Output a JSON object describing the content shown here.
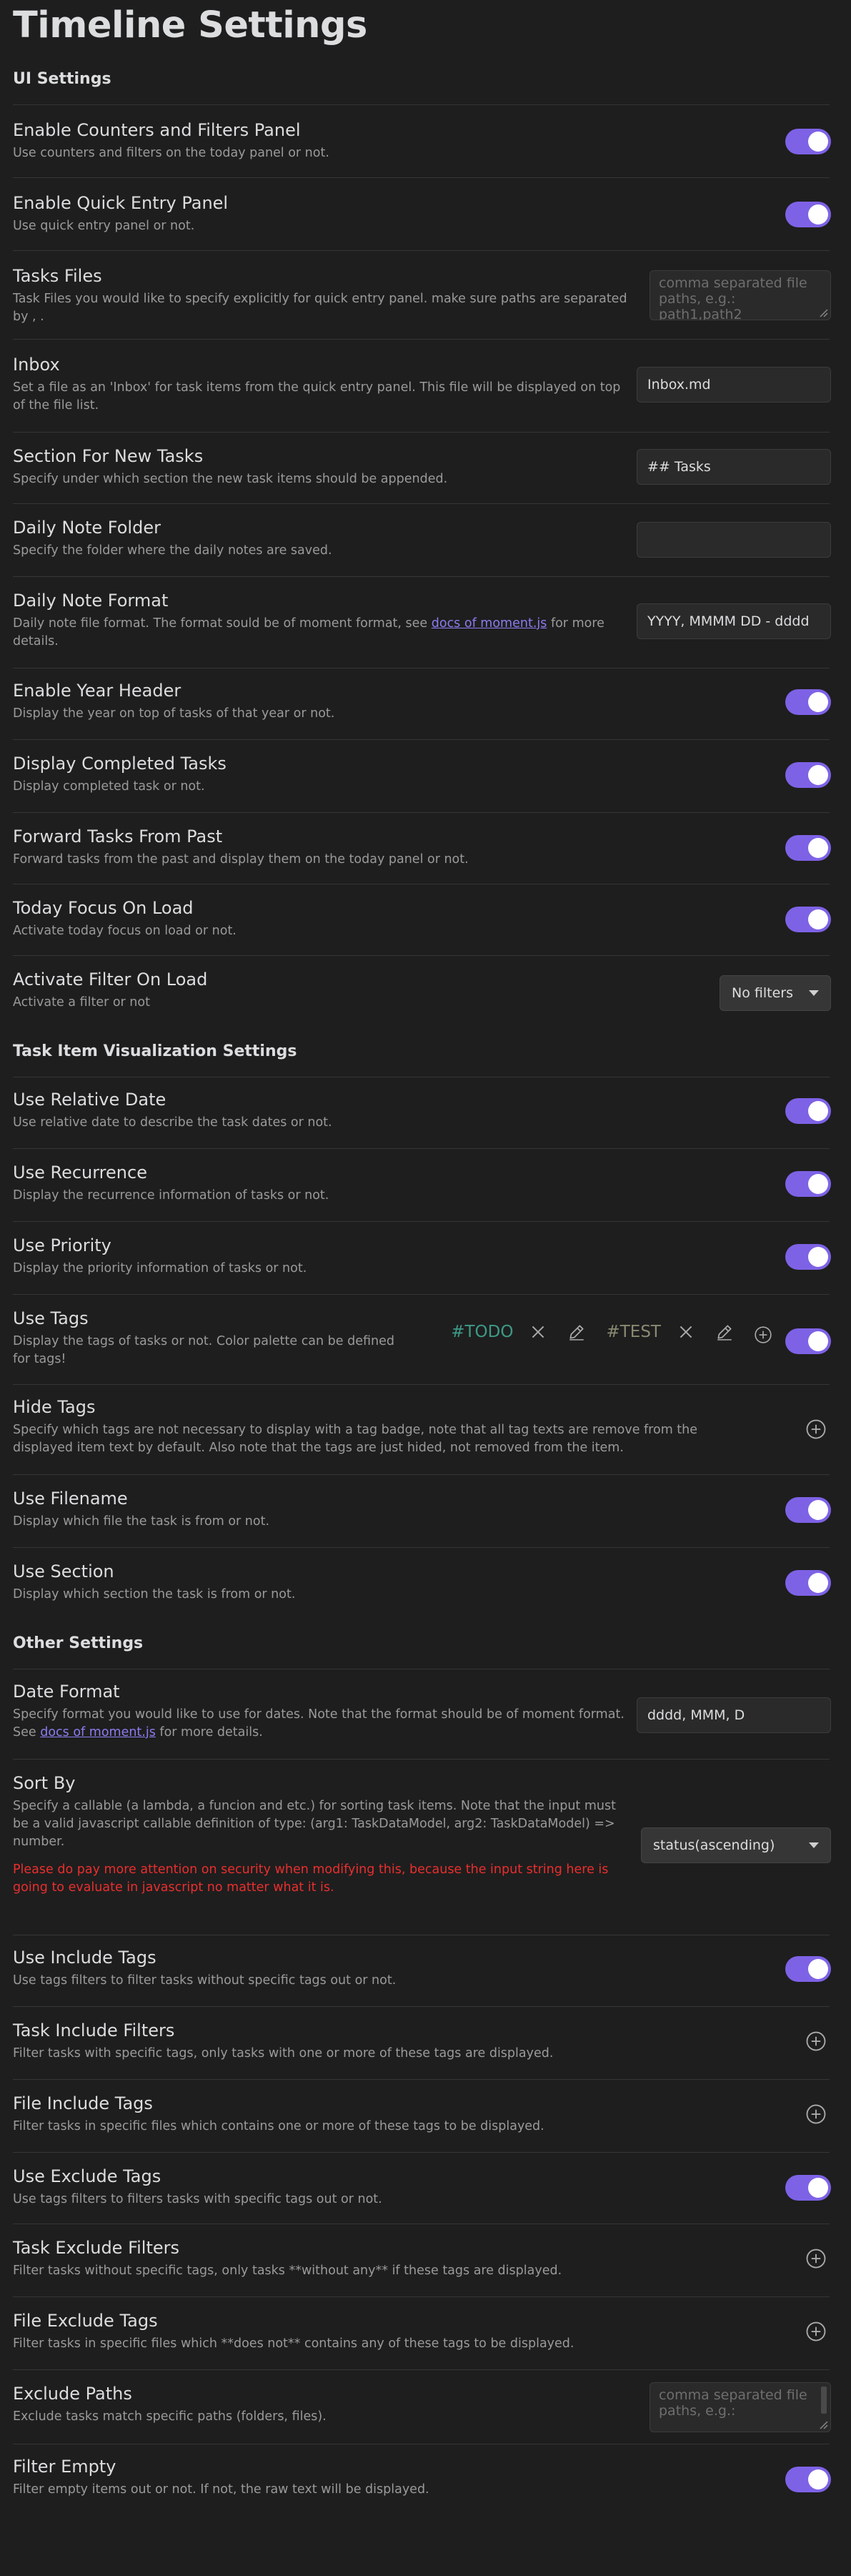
{
  "page": {
    "title": "Timeline Settings"
  },
  "colors": {
    "accent": "#7e62e6",
    "link": "#8a7cf0",
    "warning": "#ea2e2e",
    "tag_todo": "#3d9a86",
    "tag_test": "#8a8a72"
  },
  "ui": {
    "heading": "UI Settings",
    "counters": {
      "name": "Enable Counters and Filters Panel",
      "desc": "Use counters and filters on the today panel or not.",
      "enabled": true
    },
    "quick_entry": {
      "name": "Enable Quick Entry Panel",
      "desc": "Use quick entry panel or not.",
      "enabled": true
    },
    "tasks_files": {
      "name": "Tasks Files",
      "desc": "Task Files you would like to specify explicitly for quick entry panel. make sure paths are separated by , .",
      "placeholder": "comma separated file paths, e.g.: path1,path2",
      "value": ""
    },
    "inbox": {
      "name": "Inbox",
      "desc": "Set a file as an 'Inbox' for task items from the quick entry panel. This file will be displayed on top of the file list.",
      "value": "Inbox.md"
    },
    "section_new": {
      "name": "Section For New Tasks",
      "desc": "Specify under which section the new task items should be appended.",
      "value": "## Tasks"
    },
    "daily_folder": {
      "name": "Daily Note Folder",
      "desc": "Specify the folder where the daily notes are saved.",
      "value": ""
    },
    "daily_format": {
      "name": "Daily Note Format",
      "desc_before": "Daily note file format. The format sould be of moment format, see ",
      "link": "docs of moment.js",
      "desc_after": " for more details.",
      "value": "YYYY, MMMM DD - dddd"
    },
    "year_header": {
      "name": "Enable Year Header",
      "desc": "Display the year on top of tasks of that year or not.",
      "enabled": true
    },
    "completed": {
      "name": "Display Completed Tasks",
      "desc": "Display completed task or not.",
      "enabled": true
    },
    "forward": {
      "name": "Forward Tasks From Past",
      "desc": "Forward tasks from the past and display them on the today panel or not.",
      "enabled": true
    },
    "today_focus": {
      "name": "Today Focus On Load",
      "desc": "Activate today focus on load or not.",
      "enabled": true
    },
    "filter_load": {
      "name": "Activate Filter On Load",
      "desc": "Activate a filter or not",
      "selected": "No filters"
    }
  },
  "viz": {
    "heading": "Task Item Visualization Settings",
    "relative_date": {
      "name": "Use Relative Date",
      "desc": "Use relative date to describe the task dates or not.",
      "enabled": true
    },
    "recurrence": {
      "name": "Use Recurrence",
      "desc": "Display the recurrence information of tasks or not.",
      "enabled": true
    },
    "priority": {
      "name": "Use Priority",
      "desc": "Display the priority information of tasks or not.",
      "enabled": true
    },
    "tags": {
      "name": "Use Tags",
      "desc": "Display the tags of tasks or not. Color palette can be defined for tags!",
      "items": [
        "#TODO",
        "#TEST"
      ],
      "enabled": true
    },
    "hide_tags": {
      "name": "Hide Tags",
      "desc": "Specify which tags are not necessary to display with a tag badge, note that all tag texts are remove from the displayed item text by default. Also note that the tags are just hided, not removed from the item."
    },
    "filename": {
      "name": "Use Filename",
      "desc": "Display which file the task is from or not.",
      "enabled": true
    },
    "section": {
      "name": "Use Section",
      "desc": "Display which section the task is from or not.",
      "enabled": true
    }
  },
  "other": {
    "heading": "Other Settings",
    "date_format": {
      "name": "Date Format",
      "desc_before": "Specify format you would like to use for dates. Note that the format should be of moment format. See ",
      "link": "docs of moment.js",
      "desc_after": " for more details.",
      "value": "dddd, MMM, D"
    },
    "sort_by": {
      "name": "Sort By",
      "desc": "Specify a callable (a lambda, a funcion and etc.) for sorting task items. Note that the input must be a valid javascript callable definition of type: (arg1: TaskDataModel, arg2: TaskDataModel) => number.",
      "warning": "Please do pay more attention on security when modifying this, because the input string here is going to evaluate in javascript no matter what it is.",
      "selected": "status(ascending)"
    },
    "include_tags": {
      "name": "Use Include Tags",
      "desc": "Use tags filters to filter tasks without specific tags out or not.",
      "enabled": true
    },
    "task_include": {
      "name": "Task Include Filters",
      "desc": "Filter tasks with specific tags, only tasks with one or more of these tags are displayed."
    },
    "file_include": {
      "name": "File Include Tags",
      "desc": "Filter tasks in specific files which contains one or more of these tags to be displayed."
    },
    "exclude_tags": {
      "name": "Use Exclude Tags",
      "desc": "Use tags filters to filters tasks with specific tags out or not.",
      "enabled": true
    },
    "task_exclude": {
      "name": "Task Exclude Filters",
      "desc": "Filter tasks without specific tags, only tasks **without any** if these tags are displayed."
    },
    "file_exclude": {
      "name": "File Exclude Tags",
      "desc": "Filter tasks in specific files which **does not** contains any of these tags to be displayed."
    },
    "exclude_paths": {
      "name": "Exclude Paths",
      "desc": "Exclude tasks match specific paths (folders, files).",
      "placeholder": "comma separated file paths, e.g.:",
      "value": ""
    },
    "filter_empty": {
      "name": "Filter Empty",
      "desc": "Filter empty items out or not. If not, the raw text will be displayed.",
      "enabled": true
    }
  }
}
